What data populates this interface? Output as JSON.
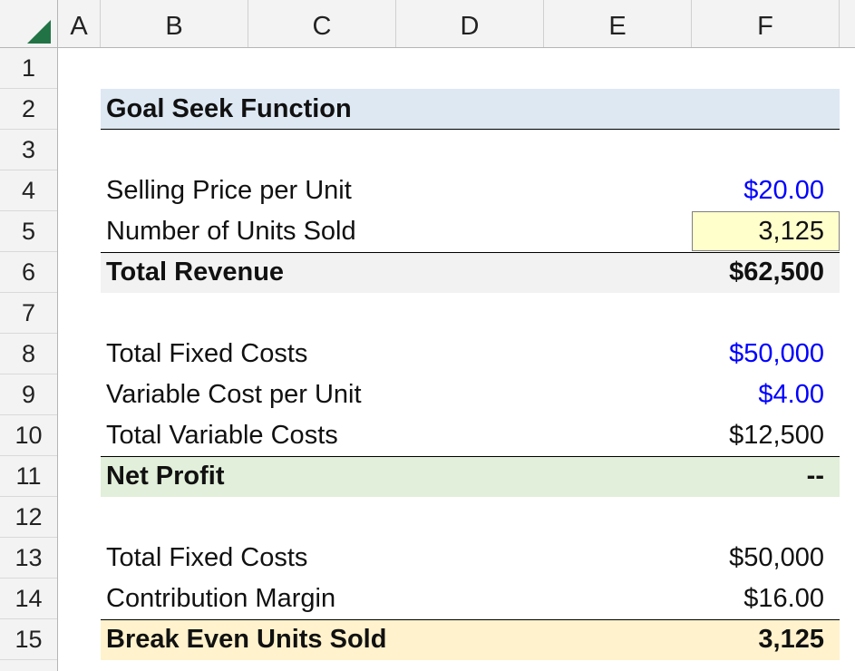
{
  "columns": [
    "A",
    "B",
    "C",
    "D",
    "E",
    "F"
  ],
  "rows": [
    "1",
    "2",
    "3",
    "4",
    "5",
    "6",
    "7",
    "8",
    "9",
    "10",
    "11",
    "12",
    "13",
    "14",
    "15"
  ],
  "colors": {
    "header_band": "#dde8f3",
    "total_band": "#f2f2f2",
    "profit_band": "#e2efda",
    "break_even_band": "#fff2cc",
    "input_fill": "#ffffcc",
    "input_font": "#0000ff"
  },
  "sheet": {
    "title": "Goal Seek Function",
    "selling_price": {
      "label": "Selling Price per Unit",
      "value": "$20.00"
    },
    "units_sold": {
      "label": "Number of Units Sold",
      "value": "3,125"
    },
    "total_revenue": {
      "label": "Total Revenue",
      "value": "$62,500"
    },
    "fixed_costs": {
      "label": "Total Fixed Costs",
      "value": "$50,000"
    },
    "variable_cost_per_unit": {
      "label": "Variable Cost per Unit",
      "value": "$4.00"
    },
    "total_variable_costs": {
      "label": "Total Variable Costs",
      "value": "$12,500"
    },
    "net_profit": {
      "label": "Net Profit",
      "value": "--"
    },
    "fixed_costs_2": {
      "label": "Total Fixed Costs",
      "value": "$50,000"
    },
    "contribution_margin": {
      "label": "Contribution Margin",
      "value": "$16.00"
    },
    "break_even_units": {
      "label": "Break Even Units Sold",
      "value": "3,125"
    }
  }
}
